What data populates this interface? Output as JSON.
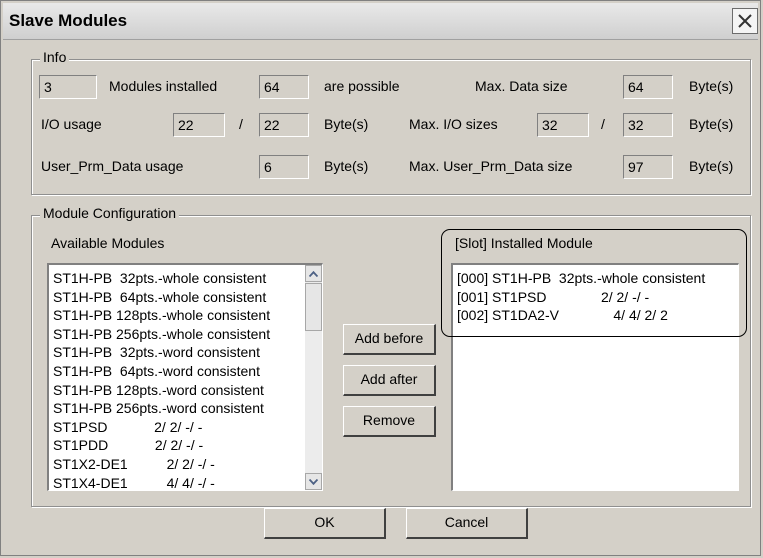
{
  "window": {
    "title": "Slave Modules"
  },
  "info": {
    "legend": "Info",
    "modules_installed_value": "3",
    "modules_installed_label": "Modules installed",
    "possible_value": "64",
    "possible_label": "are possible",
    "max_data_label": "Max. Data size",
    "max_data_value": "64",
    "max_data_unit": "Byte(s)",
    "io_usage_label": "I/O usage",
    "io_usage_in": "22",
    "io_slash": "/",
    "io_usage_out": "22",
    "io_usage_unit": "Byte(s)",
    "max_io_label": "Max. I/O sizes",
    "max_io_in": "32",
    "max_io_slash": "/",
    "max_io_out": "32",
    "max_io_unit": "Byte(s)",
    "user_prm_label": "User_Prm_Data usage",
    "user_prm_value": "6",
    "user_prm_unit": "Byte(s)",
    "max_user_prm_label": "Max. User_Prm_Data size",
    "max_user_prm_value": "97",
    "max_user_prm_unit": "Byte(s)"
  },
  "config": {
    "legend": "Module Configuration",
    "available_label": "Available Modules",
    "available_modules": [
      "ST1H-PB  32pts.-whole consistent",
      "ST1H-PB  64pts.-whole consistent",
      "ST1H-PB 128pts.-whole consistent",
      "ST1H-PB 256pts.-whole consistent",
      "ST1H-PB  32pts.-word consistent",
      "ST1H-PB  64pts.-word consistent",
      "ST1H-PB 128pts.-word consistent",
      "ST1H-PB 256pts.-word consistent",
      "ST1PSD            2/ 2/ -/ -",
      "ST1PDD            2/ 2/ -/ -",
      "ST1X2-DE1          2/ 2/ -/ -",
      "ST1X4-DE1          4/ 4/ -/ -"
    ],
    "installed_label": "[Slot] Installed Module",
    "installed_modules": [
      "[000] ST1H-PB  32pts.-whole consistent",
      "[001] ST1PSD              2/ 2/ -/ -",
      "[002] ST1DA2-V              4/ 4/ 2/ 2"
    ],
    "add_before": "Add before",
    "add_after": "Add after",
    "remove": "Remove"
  },
  "footer": {
    "ok": "OK",
    "cancel": "Cancel"
  },
  "icons": {
    "close": "close-icon",
    "scroll_up": "chevron-up-icon",
    "scroll_down": "chevron-down-icon"
  }
}
